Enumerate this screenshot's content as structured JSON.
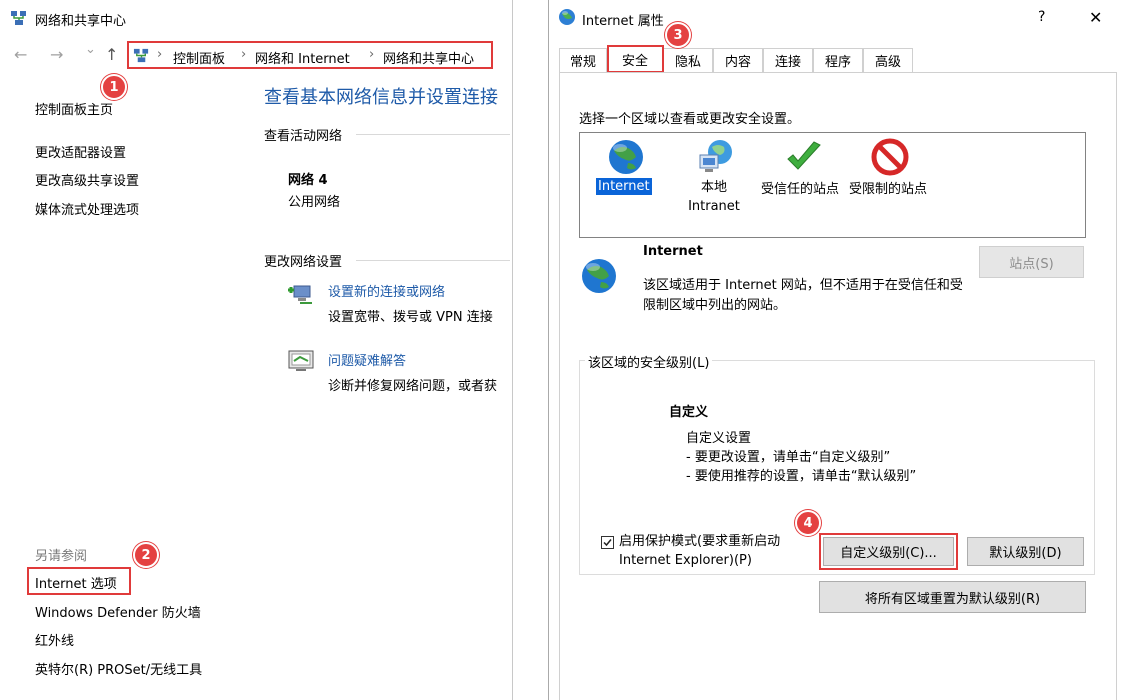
{
  "left": {
    "title": "网络和共享中心",
    "nav": {
      "back": "←",
      "forward": "→",
      "down": "⌄",
      "up": "↑"
    },
    "breadcrumb": {
      "sep": "›",
      "items": [
        "控制面板",
        "网络和 Internet",
        "网络和共享中心"
      ]
    },
    "sidebar": {
      "items": [
        "控制面板主页",
        "更改适配器设置",
        "更改高级共享设置",
        "媒体流式处理选项"
      ],
      "see_also_label": "另请参阅",
      "see_also": [
        "Internet 选项",
        "Windows Defender 防火墙",
        "红外线",
        "英特尔(R) PROSet/无线工具"
      ]
    },
    "main": {
      "heading": "查看基本网络信息并设置连接",
      "active_networks_label": "查看活动网络",
      "network_name": "网络 4",
      "network_type": "公用网络",
      "change_settings_label": "更改网络设置",
      "tasks": [
        {
          "title": "设置新的连接或网络",
          "desc": "设置宽带、拨号或 VPN 连接"
        },
        {
          "title": "问题疑难解答",
          "desc": "诊断并修复网络问题，或者获"
        }
      ]
    }
  },
  "right": {
    "title": "Internet 属性",
    "help": "?",
    "close": "✕",
    "tabs": [
      "常规",
      "安全",
      "隐私",
      "内容",
      "连接",
      "程序",
      "高级"
    ],
    "zone_prompt": "选择一个区域以查看或更改安全设置。",
    "zones": [
      {
        "label": "Internet",
        "icon": "globe-icon"
      },
      {
        "label": "本地\nIntranet",
        "icon": "intranet-icon"
      },
      {
        "label": "受信任的站点",
        "icon": "check-icon"
      },
      {
        "label": "受限制的站点",
        "icon": "restricted-icon"
      }
    ],
    "zone_title": "Internet",
    "zone_desc": "该区域适用于 Internet 网站，但不适用于在受信任和受限制区域中列出的网站。",
    "sites_button": "站点(S)",
    "level_group_label": "该区域的安全级别(L)",
    "level_title": "自定义",
    "level_desc": [
      "自定义设置",
      "- 要更改设置，请单击“自定义级别”",
      "- 要使用推荐的设置，请单击“默认级别”"
    ],
    "protected_mode_label": "启用保护模式(要求重新启动\nInternet Explorer)(P)",
    "protected_mode_checked": true,
    "custom_level_button": "自定义级别(C)...",
    "default_level_button": "默认级别(D)",
    "reset_all_button": "将所有区域重置为默认级别(R)"
  },
  "badges": [
    "1",
    "2",
    "3",
    "4"
  ],
  "colors": {
    "link": "#1e5aa8",
    "heading": "#1e5aa8",
    "annotation": "#e03a3a",
    "badge": "#e44141",
    "selection": "#0a64d8"
  }
}
